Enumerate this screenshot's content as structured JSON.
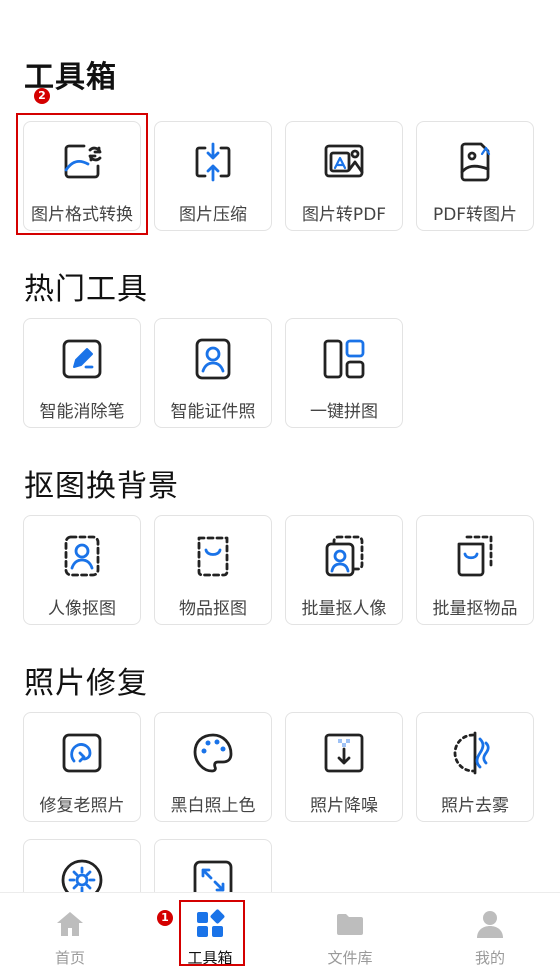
{
  "sections": [
    {
      "title": "工具箱",
      "items": [
        {
          "label": "图片格式转换",
          "icon": "image-convert-icon"
        },
        {
          "label": "图片压缩",
          "icon": "compress-icon"
        },
        {
          "label": "图片转PDF",
          "icon": "image-to-pdf-icon"
        },
        {
          "label": "PDF转图片",
          "icon": "pdf-to-image-icon"
        }
      ]
    },
    {
      "title": "热门工具",
      "items": [
        {
          "label": "智能消除笔",
          "icon": "eraser-pen-icon"
        },
        {
          "label": "智能证件照",
          "icon": "id-photo-icon"
        },
        {
          "label": "一键拼图",
          "icon": "collage-icon"
        }
      ]
    },
    {
      "title": "抠图换背景",
      "items": [
        {
          "label": "人像抠图",
          "icon": "portrait-cutout-icon"
        },
        {
          "label": "物品抠图",
          "icon": "object-cutout-icon"
        },
        {
          "label": "批量抠人像",
          "icon": "batch-portrait-icon"
        },
        {
          "label": "批量抠物品",
          "icon": "batch-object-icon"
        }
      ]
    },
    {
      "title": "照片修复",
      "items": [
        {
          "label": "修复老照片",
          "icon": "restore-photo-icon"
        },
        {
          "label": "黑白照上色",
          "icon": "palette-icon"
        },
        {
          "label": "照片降噪",
          "icon": "denoise-icon"
        },
        {
          "label": "照片去雾",
          "icon": "dehaze-icon"
        },
        {
          "label": "",
          "icon": "brightness-icon"
        },
        {
          "label": "",
          "icon": "expand-icon"
        }
      ]
    }
  ],
  "tabbar": [
    {
      "label": "首页",
      "icon": "home-icon"
    },
    {
      "label": "工具箱",
      "icon": "toolbox-icon"
    },
    {
      "label": "文件库",
      "icon": "folder-icon"
    },
    {
      "label": "我的",
      "icon": "user-icon"
    }
  ],
  "annotations": {
    "badge_1": "1",
    "badge_2": "2"
  },
  "colors": {
    "accent": "#1a73e8",
    "icon_stroke": "#222222",
    "highlight": "#d40000",
    "inactive": "#9a9a9a"
  }
}
